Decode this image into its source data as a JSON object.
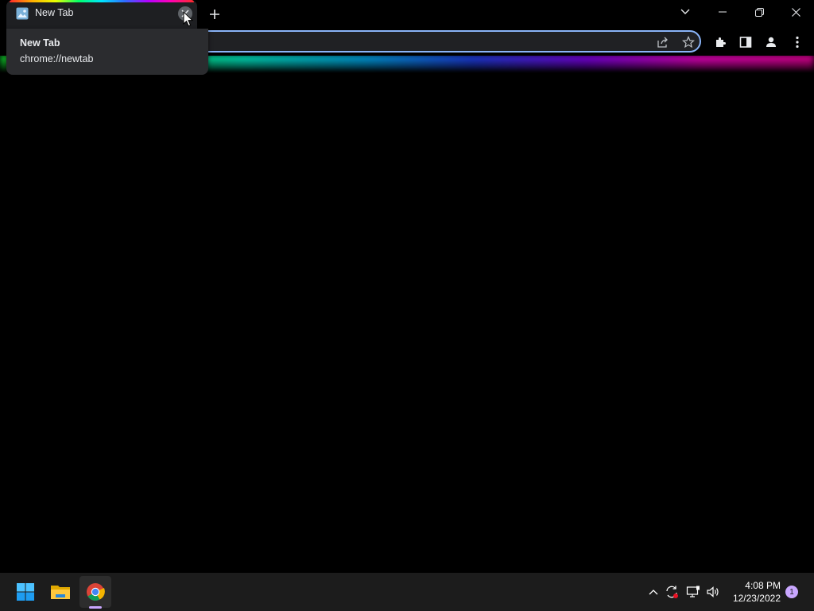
{
  "browser": {
    "tab": {
      "title": "New Tab"
    },
    "hovercard": {
      "title": "New Tab",
      "url": "chrome://newtab"
    },
    "omnibox": {
      "value": ""
    }
  },
  "taskbar": {
    "clock": {
      "time": "4:08 PM",
      "date": "12/23/2022"
    },
    "notifications": {
      "count": "1"
    }
  },
  "colors": {
    "omnibox_border": "#8ab4f8",
    "tab_bg": "#1e1f22",
    "hovercard_bg": "#2b2c2f",
    "taskbar_bg": "#1c1c1c",
    "accent": "#c9a7ff"
  },
  "icons": {
    "tab": [
      "favicon-icon",
      "close-icon"
    ],
    "toolbar": [
      "share-icon",
      "star-icon",
      "extensions-icon",
      "side-panel-icon",
      "profile-icon",
      "menu-icon"
    ],
    "window": [
      "tab-search-icon",
      "minimize-icon",
      "restore-icon",
      "close-window-icon"
    ],
    "taskbar": [
      "windows-start-icon",
      "file-explorer-icon",
      "chrome-icon"
    ],
    "tray": [
      "chevron-up-icon",
      "sync-icon",
      "network-icon",
      "volume-icon"
    ]
  }
}
